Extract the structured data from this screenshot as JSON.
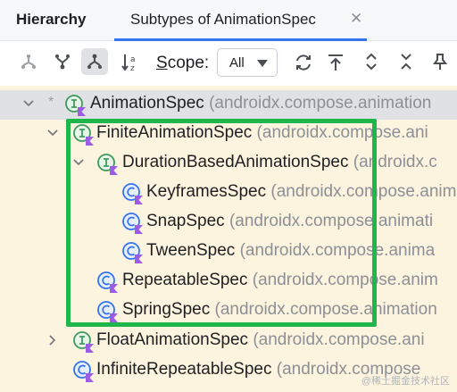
{
  "header": {
    "panel_title": "Hierarchy",
    "tab_label": "Subtypes of AnimationSpec",
    "tab_close": "✕"
  },
  "toolbar": {
    "scope_label_first": "S",
    "scope_label_rest": "cope:",
    "scope_value": "All"
  },
  "tree": [
    {
      "name": "AnimationSpec",
      "pkg": "(androidx.compose.animation"
    },
    {
      "name": "FiniteAnimationSpec",
      "pkg": "(androidx.compose.ani"
    },
    {
      "name": "DurationBasedAnimationSpec",
      "pkg": "(androidx.c"
    },
    {
      "name": "KeyframesSpec",
      "pkg": "(androidx.compose.anim"
    },
    {
      "name": "SnapSpec",
      "pkg": "(androidx.compose.animati"
    },
    {
      "name": "TweenSpec",
      "pkg": "(androidx.compose.anima"
    },
    {
      "name": "RepeatableSpec",
      "pkg": "(androidx.compose.anim"
    },
    {
      "name": "SpringSpec",
      "pkg": "(androidx.compose.animation"
    },
    {
      "name": "FloatAnimationSpec",
      "pkg": "(androidx.compose.ani"
    },
    {
      "name": "InfiniteRepeatableSpec",
      "pkg": "(androidx.compose"
    }
  ],
  "root_marker": "*",
  "watermark": "@稀土掘金技术社区",
  "colors": {
    "accent": "#3574f0",
    "highlight": "#1fb74c",
    "interface_icon": "#3e9b5c",
    "class_icon": "#3574f0",
    "kotlin_badge": "#9c5ce6"
  },
  "icons": {
    "interface": "interface-icon",
    "class": "class-icon"
  }
}
